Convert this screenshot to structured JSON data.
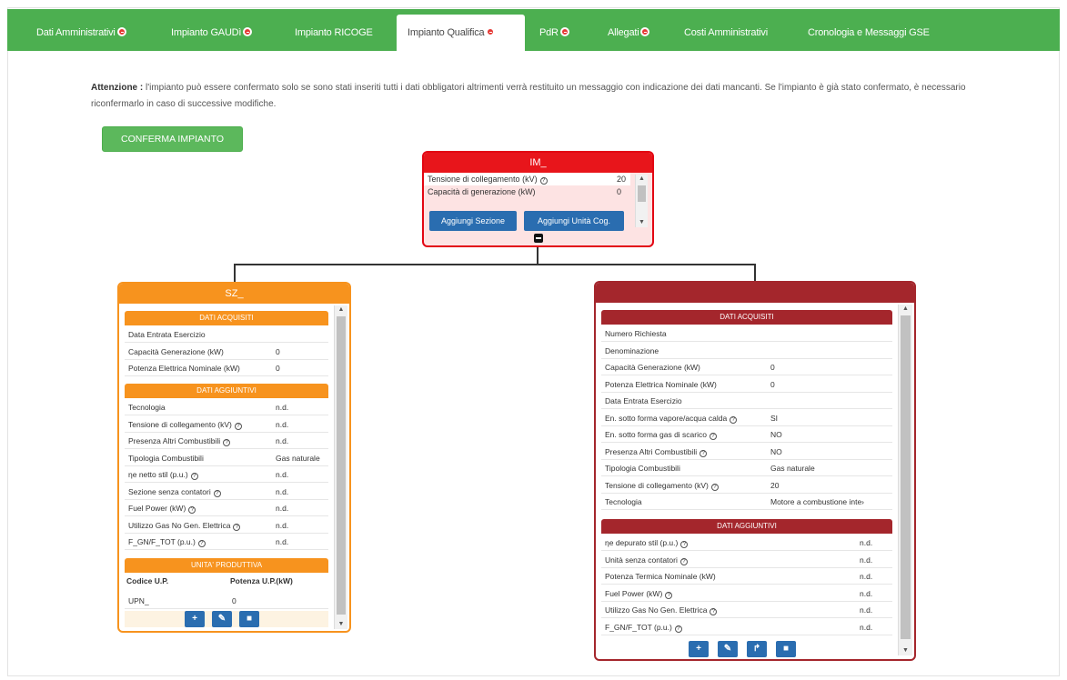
{
  "tabs": [
    {
      "label": "Dati Amministrativi",
      "alert": true
    },
    {
      "label": "Impianto GAUDì",
      "alert": true
    },
    {
      "label": "Impianto RICOGE",
      "alert": false
    },
    {
      "label": "Impianto Qualifica",
      "alert": true,
      "active": true
    },
    {
      "label": "PdR",
      "alert": true
    },
    {
      "label": "Allegati",
      "alert": true
    },
    {
      "label": "Costi Amministrativi",
      "alert": false
    },
    {
      "label": "Cronologia e Messaggi GSE",
      "alert": false
    }
  ],
  "notice": {
    "prefix": "Attenzione :",
    "text": " l'impianto può essere confermato solo se sono stati inseriti tutti i dati obbligatori altrimenti verrà restituito un messaggio con indicazione dei dati mancanti. Se l'impianto è già stato confermato, è necessario riconfermarlo in caso di successive modifiche."
  },
  "confirm_button": "CONFERMA IMPIANTO",
  "im_node": {
    "title": "IM_",
    "rows": [
      {
        "label": "Tensione di collegamento (kV)",
        "value": "20"
      },
      {
        "label": "Capacità di generazione (kW)",
        "value": "0"
      }
    ],
    "add_section": "Aggiungi Sezione",
    "add_unit": "Aggiungi Unità Cog."
  },
  "sz_node": {
    "title": "SZ_",
    "acquired_title": "DATI ACQUISITI",
    "acquired": [
      {
        "label": "Data Entrata Esercizio",
        "value": ""
      },
      {
        "label": "Capacità Generazione (kW)",
        "value": "0"
      },
      {
        "label": "Potenza Elettrica Nominale (kW)",
        "value": "0"
      }
    ],
    "additional_title": "DATI AGGIUNTIVI",
    "additional": [
      {
        "label": "Tecnologia",
        "value": "n.d."
      },
      {
        "label": "Tensione di collegamento (kV)",
        "value": "n.d."
      },
      {
        "label": "Presenza Altri Combustibili",
        "value": "n.d."
      },
      {
        "label": "Tipologia Combustibili",
        "value": "Gas naturale"
      },
      {
        "label": "ηe netto stil (p.u.)",
        "value": "n.d."
      },
      {
        "label": "Sezione senza contatori",
        "value": "n.d."
      },
      {
        "label": "Fuel Power (kW)",
        "value": "n.d."
      },
      {
        "label": "Utilizzo Gas No Gen. Elettrica",
        "value": "n.d."
      },
      {
        "label": "F_GN/F_TOT (p.u.)",
        "value": "n.d."
      }
    ],
    "units_title": "UNITA' PRODUTTIVA",
    "units_col1": "Codice U.P.",
    "units_col2": "Potenza U.P.(kW)",
    "unit_code": "UPN_",
    "unit_power": "0"
  },
  "rw_node": {
    "acquired_title": "DATI ACQUISITI",
    "acquired": [
      {
        "label": "Numero Richiesta",
        "value": ""
      },
      {
        "label": "Denominazione",
        "value": ""
      },
      {
        "label": "Capacità Generazione (kW)",
        "value": "0"
      },
      {
        "label": "Potenza Elettrica Nominale (kW)",
        "value": "0"
      },
      {
        "label": "Data Entrata Esercizio",
        "value": ""
      },
      {
        "label": "En. sotto forma vapore/acqua calda",
        "value": "SI"
      },
      {
        "label": "En. sotto forma gas di scarico",
        "value": "NO"
      },
      {
        "label": "Presenza Altri Combustibili",
        "value": "NO"
      },
      {
        "label": "Tipologia Combustibili",
        "value": "Gas naturale"
      },
      {
        "label": "Tensione di collegamento (kV)",
        "value": "20"
      },
      {
        "label": "Tecnologia",
        "value": "Motore a combustione inte›"
      }
    ],
    "additional_title": "DATI AGGIUNTIVI",
    "additional": [
      {
        "label": "ηe depurato stil (p.u.)",
        "value": "n.d."
      },
      {
        "label": "Unità senza contatori",
        "value": "n.d."
      },
      {
        "label": "Potenza Termica Nominale (kW)",
        "value": "n.d."
      },
      {
        "label": "Fuel Power (kW)",
        "value": "n.d."
      },
      {
        "label": "Utilizzo Gas No Gen. Elettrica",
        "value": "n.d."
      },
      {
        "label": "F_GN/F_TOT (p.u.)",
        "value": "n.d."
      }
    ]
  },
  "colors": {
    "green": "#4caf50",
    "red": "#e8151b",
    "orange": "#f7931e",
    "maroon": "#a4262c",
    "blue": "#2a6db0"
  }
}
